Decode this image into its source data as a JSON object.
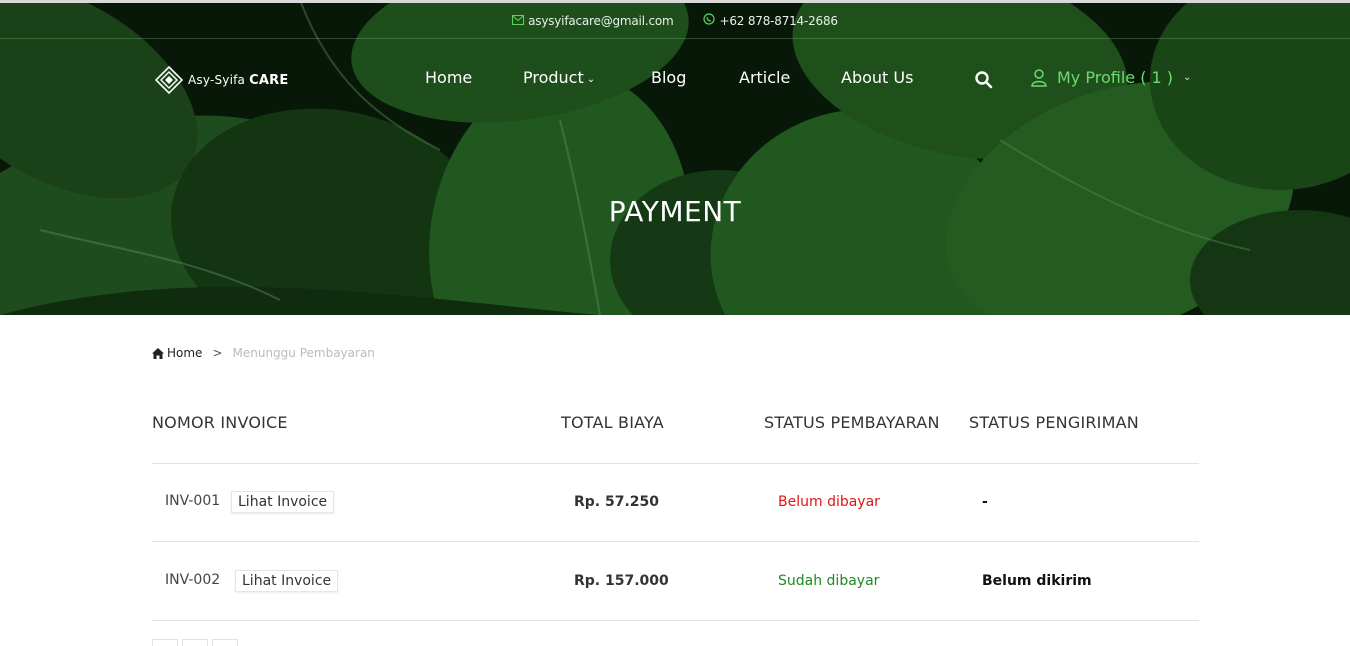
{
  "topbar": {
    "email": "asysyifacare@gmail.com",
    "phone": "+62 878-8714-2686"
  },
  "logo": {
    "text_prefix": "Asy-Syifa",
    "text_bold": "CARE"
  },
  "nav": {
    "items": [
      "Home",
      "Product",
      "Blog",
      "Article",
      "About Us"
    ],
    "profile_label": "My Profile ( 1 )"
  },
  "hero": {
    "title": "PAYMENT"
  },
  "breadcrumb": {
    "home": "Home",
    "separator": ">",
    "current": "Menunggu Pembayaran"
  },
  "table": {
    "headers": [
      "NOMOR INVOICE",
      "TOTAL BIAYA",
      "STATUS PEMBAYARAN",
      "STATUS PENGIRIMAN"
    ],
    "rows": [
      {
        "invoice": "INV-001",
        "button": "Lihat Invoice",
        "total": "Rp. 57.250",
        "payment_status": "Belum dibayar",
        "shipping_status": "-"
      },
      {
        "invoice": "INV-002",
        "button": "Lihat Invoice",
        "total": "Rp. 157.000",
        "payment_status": "Sudah dibayar",
        "shipping_status": "Belum dikirim"
      }
    ]
  },
  "colors": {
    "accent_green": "#6fd96f",
    "unpaid_red": "#e01414",
    "paid_green": "#1e8a1e"
  },
  "icons": [
    "envelope-icon",
    "whatsapp-icon",
    "logo-icon",
    "search-icon",
    "user-icon",
    "home-icon",
    "chevron-down-icon"
  ]
}
